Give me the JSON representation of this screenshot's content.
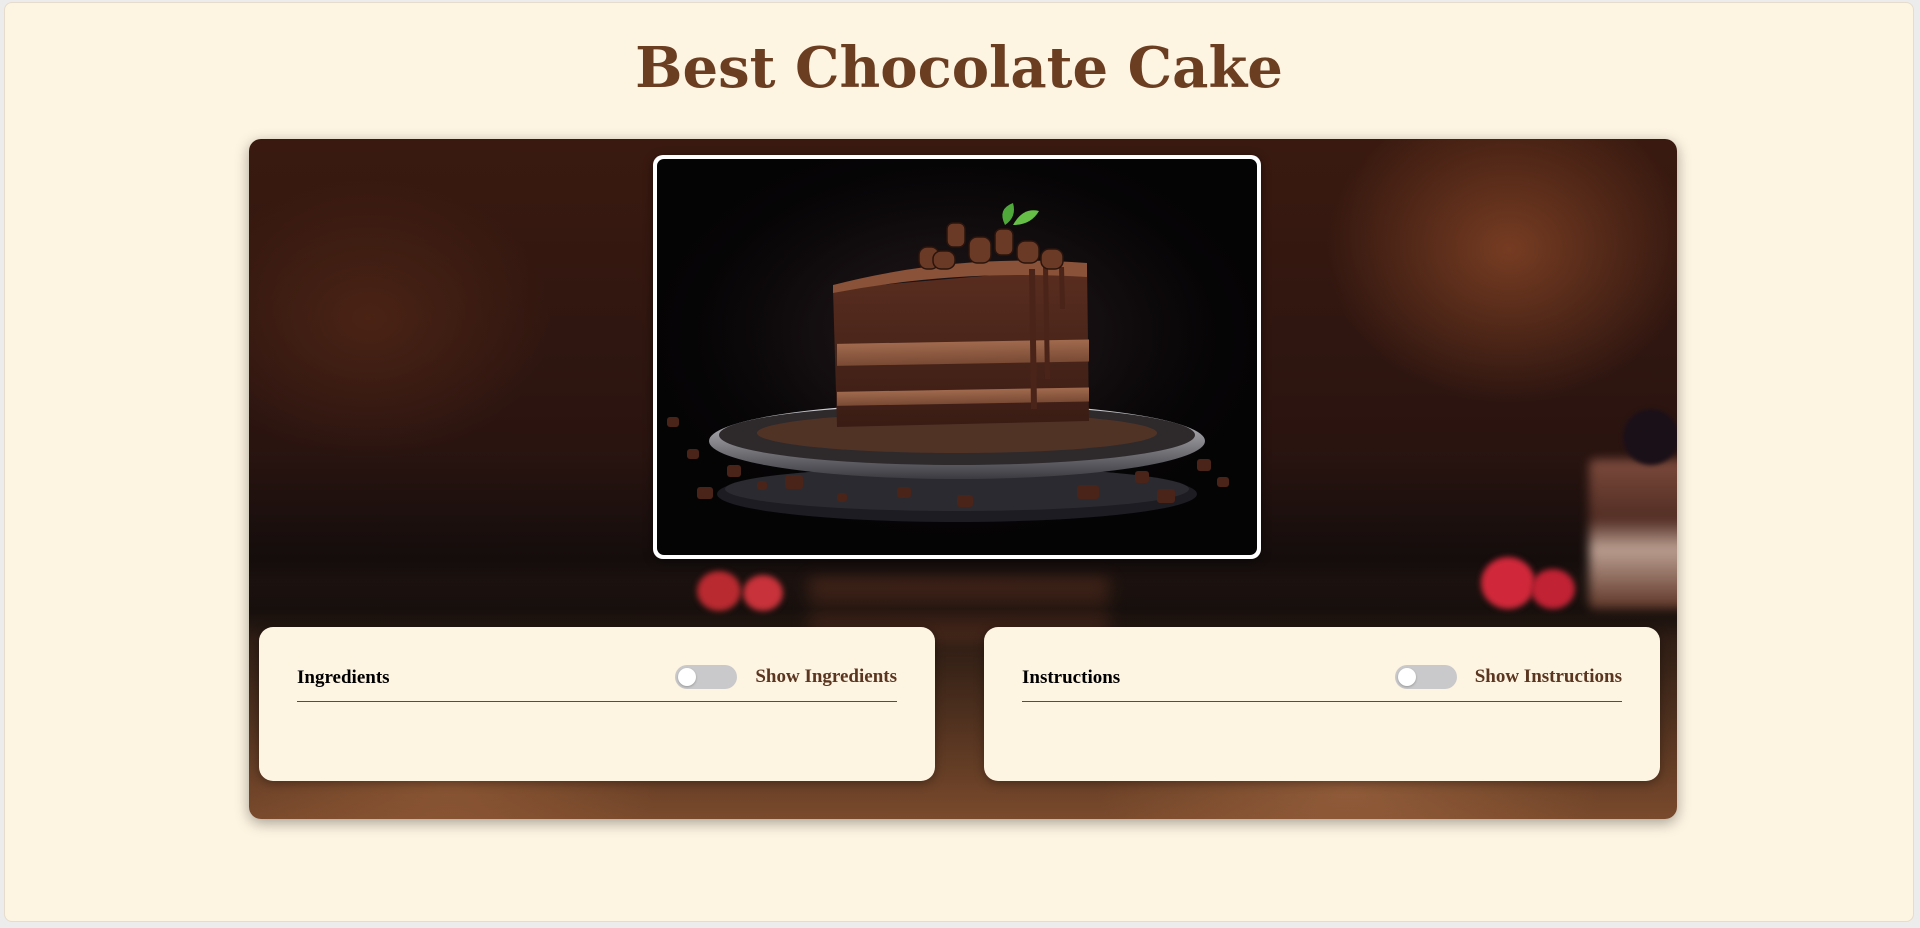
{
  "page": {
    "title": "Best Chocolate Cake"
  },
  "hero": {
    "image_icon": "chocolate-cake-slice-photo"
  },
  "ingredients": {
    "heading": "Ingredients",
    "toggle_label": "Show Ingredients",
    "toggle_on": false
  },
  "instructions": {
    "heading": "Instructions",
    "toggle_label": "Show Instructions",
    "toggle_on": false
  },
  "colors": {
    "page_bg": "#fef4e2",
    "title": "#6b3e22",
    "toggle_label": "#5a3620",
    "toggle_track_off": "#c9c9cb"
  }
}
